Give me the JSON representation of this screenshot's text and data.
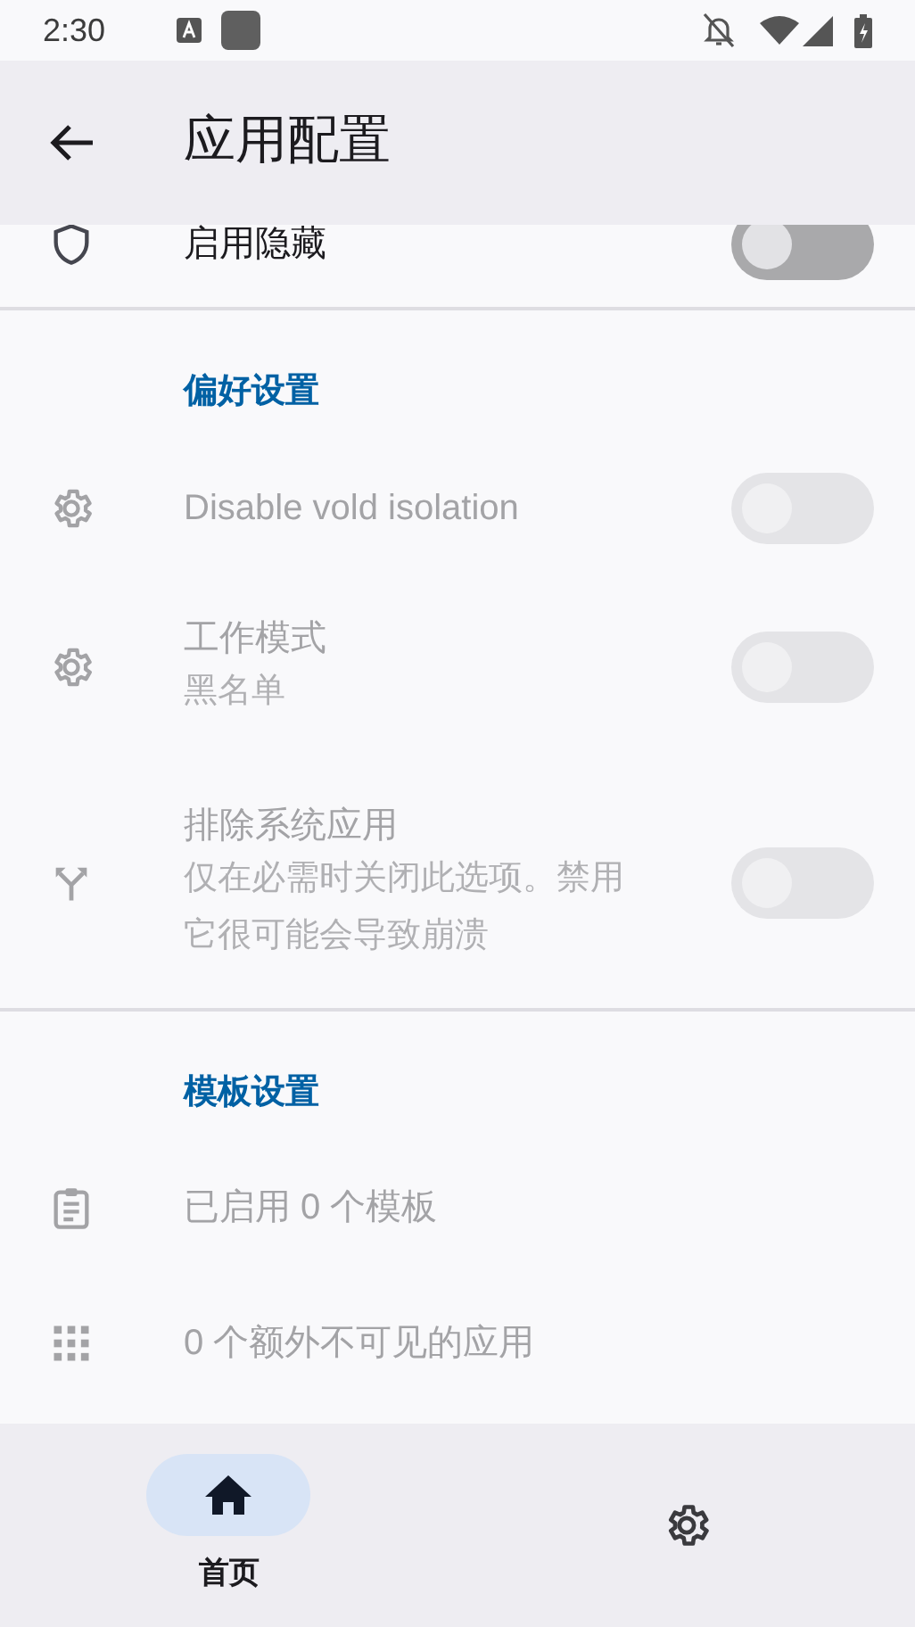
{
  "status_bar": {
    "time": "2:30"
  },
  "app_bar": {
    "title": "应用配置"
  },
  "sections": [
    {
      "items": [
        {
          "kind": "switch",
          "title": "启用隐藏",
          "on": false,
          "disabled": false
        }
      ]
    },
    {
      "header": "偏好设置",
      "items": [
        {
          "kind": "switch",
          "title": "Disable vold isolation",
          "on": false,
          "disabled": true
        },
        {
          "kind": "switch",
          "title": "工作模式",
          "subtitle": "黑名单",
          "on": false,
          "disabled": true
        },
        {
          "kind": "switch",
          "title": "排除系统应用",
          "subtitle": "仅在必需时关闭此选项。禁用它很可能会导致崩溃",
          "on": false,
          "disabled": true
        }
      ]
    },
    {
      "header": "模板设置",
      "items": [
        {
          "kind": "info",
          "title": "已启用 0 个模板"
        },
        {
          "kind": "info",
          "title": "0 个额外不可见的应用"
        }
      ]
    }
  ],
  "bottom_nav": [
    {
      "label": "首页",
      "selected": true
    },
    {
      "selected": false
    }
  ]
}
